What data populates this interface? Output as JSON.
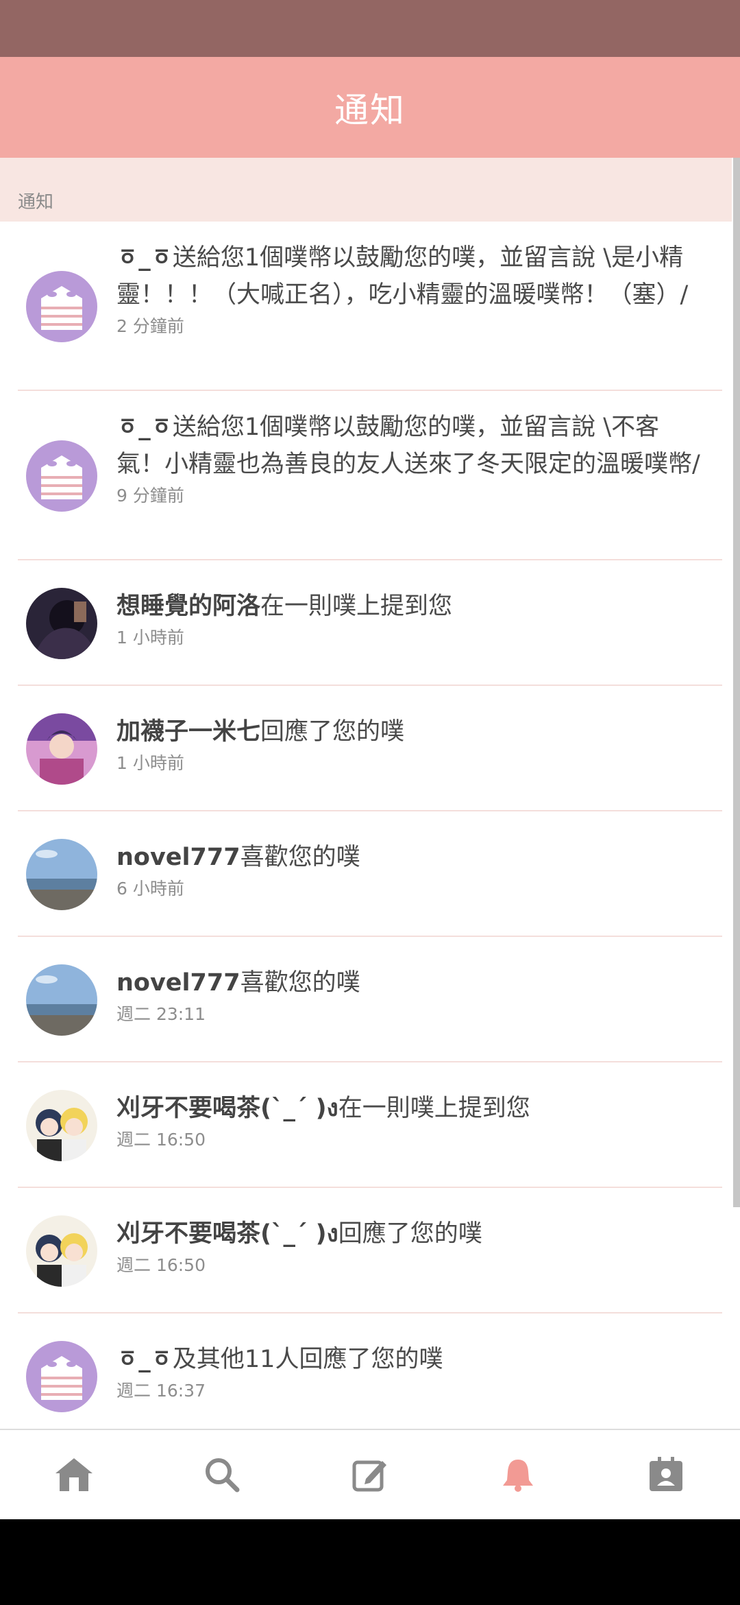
{
  "header": {
    "title": "通知"
  },
  "section": {
    "label": "通知"
  },
  "notifications": [
    {
      "name": "ㆆ_ㆆ",
      "text": "送給您1個噗幣以鼓勵您的噗，並留言說 \\是小精靈！！！（大喊正名），吃小精靈的溫暖噗幣！（塞）/",
      "time": "2 分鐘前",
      "avatar": "mask-avatar"
    },
    {
      "name": "ㆆ_ㆆ",
      "text": "送給您1個噗幣以鼓勵您的噗，並留言說 \\不客氣！小精靈也為善良的友人送來了冬天限定的溫暖噗幣/",
      "time": "9 分鐘前",
      "avatar": "mask-avatar"
    },
    {
      "name": "想睡覺的阿洛",
      "text": "在一則噗上提到您",
      "time": "1 小時前",
      "avatar": "dark-avatar"
    },
    {
      "name": "加襪子一米七",
      "text": "回應了您的噗",
      "time": "1 小時前",
      "avatar": "anime-avatar"
    },
    {
      "name": "novel777",
      "text": "喜歡您的噗",
      "time": "6 小時前",
      "avatar": "beach-avatar"
    },
    {
      "name": "novel777",
      "text": "喜歡您的噗",
      "time": "週二 23:11",
      "avatar": "beach-avatar"
    },
    {
      "name": "刈牙不要喝茶(ˋ_ˊ )ง",
      "text": "在一則噗上提到您",
      "time": "週二 16:50",
      "avatar": "duo-avatar"
    },
    {
      "name": "刈牙不要喝茶(ˋ_ˊ )ง",
      "text": "回應了您的噗",
      "time": "週二 16:50",
      "avatar": "duo-avatar"
    },
    {
      "name": "ㆆ_ㆆ",
      "text": "及其他11人回應了您的噗",
      "time": "週二 16:37",
      "avatar": "mask-avatar"
    }
  ],
  "nav": [
    {
      "icon": "home-icon",
      "label": "home"
    },
    {
      "icon": "search-icon",
      "label": "search"
    },
    {
      "icon": "compose-icon",
      "label": "compose"
    },
    {
      "icon": "bell-icon",
      "label": "notifications",
      "active": true
    },
    {
      "icon": "profile-icon",
      "label": "profile"
    }
  ],
  "colors": {
    "header": "#f3a9a3",
    "status_bar": "#936663",
    "section": "#f8e6e2",
    "active_icon": "#f29a94",
    "icon": "#8a8a8a"
  }
}
